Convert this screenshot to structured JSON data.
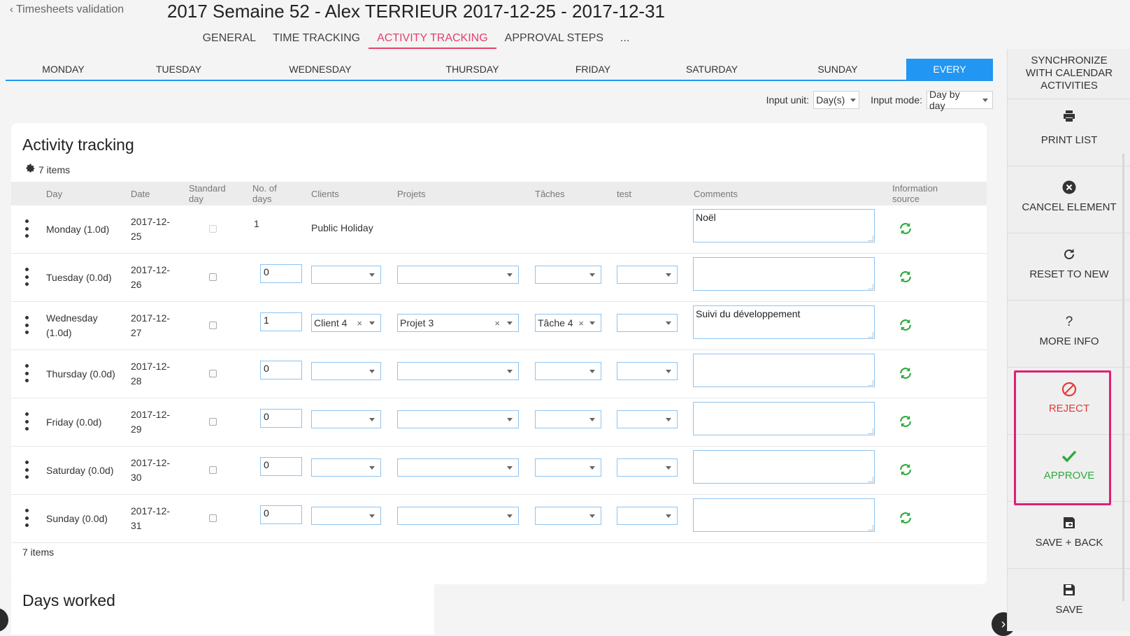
{
  "header": {
    "back_label": "Timesheets validation",
    "title": "2017 Semaine 52 - Alex TERRIEUR 2017-12-25 - 2017-12-31",
    "tabs": [
      "GENERAL",
      "TIME TRACKING",
      "ACTIVITY TRACKING",
      "APPROVAL STEPS",
      "..."
    ],
    "active_tab": "ACTIVITY TRACKING"
  },
  "day_tabs": [
    "MONDAY",
    "TUESDAY",
    "WEDNESDAY",
    "THURSDAY",
    "FRIDAY",
    "SATURDAY",
    "SUNDAY",
    "EVERY"
  ],
  "active_day_tab": "EVERY",
  "inputs": {
    "unit_label": "Input unit:",
    "unit_value": "Day(s)",
    "mode_label": "Input mode:",
    "mode_value": "Day by day"
  },
  "activity": {
    "title": "Activity tracking",
    "count": "7 items",
    "footer_count": "7 items",
    "columns": {
      "day": "Day",
      "date": "Date",
      "standard": "Standard day",
      "days": "No. of days",
      "clients": "Clients",
      "projets": "Projets",
      "taches": "Tâches",
      "test": "test",
      "comments": "Comments",
      "source": "Information source"
    },
    "rows": [
      {
        "day": "Monday (1.0d)",
        "date": "2017-12-25",
        "days": "1",
        "client": "Public Holiday",
        "projet": "",
        "tache": "",
        "comment": "Noël"
      },
      {
        "day": "Tuesday (0.0d)",
        "date": "2017-12-26",
        "days": "0",
        "client": "",
        "projet": "",
        "tache": "",
        "comment": ""
      },
      {
        "day": "Wednesday (1.0d)",
        "date": "2017-12-27",
        "days": "1",
        "client": "Client 4",
        "projet": "Projet 3",
        "tache": "Tâche 4",
        "comment": "Suivi du développement"
      },
      {
        "day": "Thursday (0.0d)",
        "date": "2017-12-28",
        "days": "0",
        "client": "",
        "projet": "",
        "tache": "",
        "comment": ""
      },
      {
        "day": "Friday (0.0d)",
        "date": "2017-12-29",
        "days": "0",
        "client": "",
        "projet": "",
        "tache": "",
        "comment": ""
      },
      {
        "day": "Saturday (0.0d)",
        "date": "2017-12-30",
        "days": "0",
        "client": "",
        "projet": "",
        "tache": "",
        "comment": ""
      },
      {
        "day": "Sunday (0.0d)",
        "date": "2017-12-31",
        "days": "0",
        "client": "",
        "projet": "",
        "tache": "",
        "comment": ""
      }
    ]
  },
  "days_worked": {
    "title": "Days worked"
  },
  "side_actions": {
    "sync": "SYNCHRONIZE WITH CALENDAR ACTIVITIES",
    "print": "PRINT LIST",
    "cancel": "CANCEL ELEMENT",
    "reset": "RESET TO NEW",
    "info": "MORE INFO",
    "reject": "REJECT",
    "approve": "APPROVE",
    "save_back": "SAVE + BACK",
    "save": "SAVE"
  },
  "colors": {
    "accent": "#2196f3",
    "active_tab": "#e53e6b",
    "reject": "#e53935",
    "approve": "#2eaa3c",
    "highlight": "#e01e76",
    "sync_icon": "#2eaa3c"
  }
}
